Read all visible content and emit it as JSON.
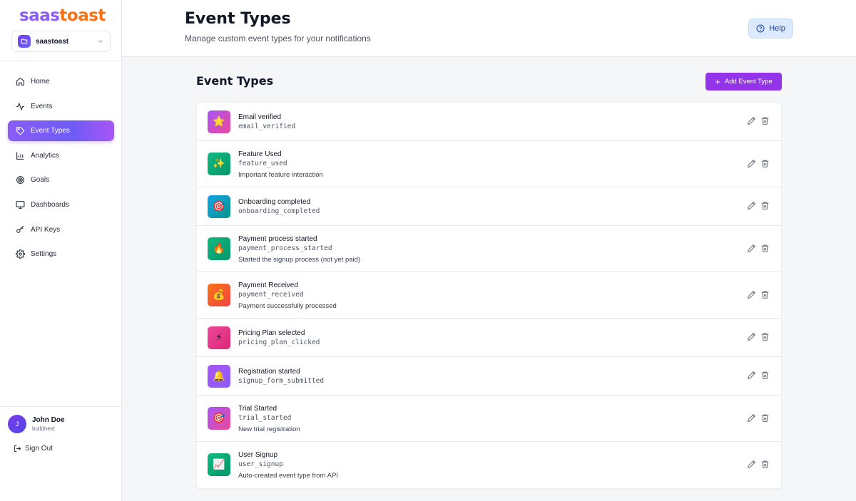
{
  "brand": {
    "part1": "saas",
    "part2": "toast"
  },
  "workspace": {
    "name": "saastoast"
  },
  "nav": [
    {
      "label": "Home",
      "icon": "home-icon"
    },
    {
      "label": "Events",
      "icon": "activity-icon"
    },
    {
      "label": "Event Types",
      "icon": "tag-icon",
      "active": true
    },
    {
      "label": "Analytics",
      "icon": "bar-chart-icon"
    },
    {
      "label": "Goals",
      "icon": "target-icon"
    },
    {
      "label": "Dashboards",
      "icon": "monitor-icon"
    },
    {
      "label": "API Keys",
      "icon": "key-icon"
    },
    {
      "label": "Settings",
      "icon": "gear-icon"
    }
  ],
  "user": {
    "initial": "J",
    "name": "John Doe",
    "org": "buildnext"
  },
  "sign_out": "Sign Out",
  "header": {
    "title": "Event Types",
    "subtitle": "Manage custom event types for your notifications",
    "help": "Help"
  },
  "section": {
    "title": "Event Types",
    "add_button": "Add Event Type"
  },
  "colors": {
    "accent": "#9333ea",
    "active_nav": "#8b5cf6"
  },
  "event_types": [
    {
      "name": "Email verified",
      "key": "email_verified",
      "description": "",
      "emoji": "⭐",
      "bg": "linear-gradient(135deg,#a855f7,#ec4899)"
    },
    {
      "name": "Feature Used",
      "key": "feature_used",
      "description": "Important feature interaction",
      "emoji": "✨",
      "bg": "linear-gradient(135deg,#10b981,#059669)"
    },
    {
      "name": "Onboarding completed",
      "key": "onboarding_completed",
      "description": "",
      "emoji": "🎯",
      "bg": "linear-gradient(135deg,#0ea5e9,#0d9488)"
    },
    {
      "name": "Payment process started",
      "key": "payment_process_started",
      "description": "Started the signup process (not yet paid)",
      "emoji": "🔥",
      "bg": "linear-gradient(135deg,#10b981,#059669)"
    },
    {
      "name": "Payment Received",
      "key": "payment_received",
      "description": "Payment successfully processed",
      "emoji": "💰",
      "bg": "linear-gradient(135deg,#f97316,#ef4444)"
    },
    {
      "name": "Pricing Plan selected",
      "key": "pricing_plan_clicked",
      "description": "",
      "emoji": "⚡",
      "bg": "linear-gradient(135deg,#ec4899,#db2777)"
    },
    {
      "name": "Registration started",
      "key": "signup_form_submitted",
      "description": "",
      "emoji": "🔔",
      "bg": "linear-gradient(135deg,#a855f7,#8b5cf6)"
    },
    {
      "name": "Trial Started",
      "key": "trial_started",
      "description": "New trial registration",
      "emoji": "🎯",
      "bg": "linear-gradient(135deg,#a855f7,#ec4899)"
    },
    {
      "name": "User Signup",
      "key": "user_signup",
      "description": "Auto-created event type from API",
      "emoji": "📈",
      "bg": "linear-gradient(135deg,#10b981,#059669)"
    }
  ]
}
